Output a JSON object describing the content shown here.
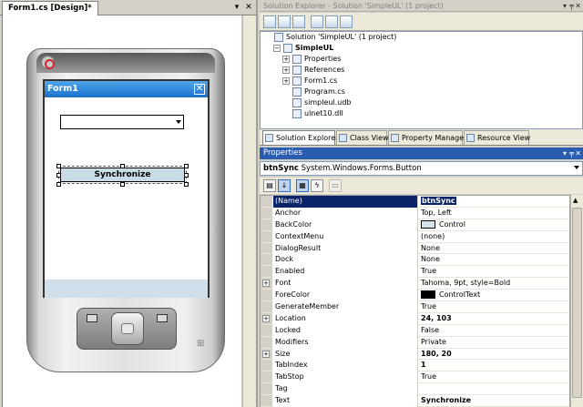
{
  "designer": {
    "tab_label": "Form1.cs [Design]*",
    "form": {
      "title": "Form1",
      "close_glyph": "✕",
      "combo_value": "",
      "button_label": "Synchronize"
    }
  },
  "solution_explorer": {
    "title": "Solution Explorer - Solution 'SimpleUL' (1 project)",
    "tree": [
      {
        "label": "Solution 'SimpleUL' (1 project)",
        "level": 0,
        "expander": "",
        "icon": "solution-icon",
        "bold": false
      },
      {
        "label": "SimpleUL",
        "level": 1,
        "expander": "−",
        "icon": "project-icon",
        "bold": true
      },
      {
        "label": "Properties",
        "level": 2,
        "expander": "+",
        "icon": "folder-icon",
        "bold": false
      },
      {
        "label": "References",
        "level": 2,
        "expander": "+",
        "icon": "folder-icon",
        "bold": false
      },
      {
        "label": "Form1.cs",
        "level": 2,
        "expander": "+",
        "icon": "form-icon",
        "bold": false
      },
      {
        "label": "Program.cs",
        "level": 2,
        "expander": "",
        "icon": "cs-file-icon",
        "bold": false
      },
      {
        "label": "simpleul.udb",
        "level": 2,
        "expander": "",
        "icon": "db-file-icon",
        "bold": false
      },
      {
        "label": "ulnet10.dll",
        "level": 2,
        "expander": "",
        "icon": "dll-file-icon",
        "bold": false
      }
    ]
  },
  "bottom_tabs": [
    {
      "label": "Solution Explorer",
      "active": true
    },
    {
      "label": "Class View",
      "active": false
    },
    {
      "label": "Property Manager",
      "active": false
    },
    {
      "label": "Resource View",
      "active": false
    }
  ],
  "properties": {
    "title": "Properties",
    "object_name": "btnSync",
    "object_type": "System.Windows.Forms.Button",
    "rows": [
      {
        "name": "(Name)",
        "value": "btnSync",
        "bold": true,
        "selected": true,
        "expander": "",
        "swatch": ""
      },
      {
        "name": "Anchor",
        "value": "Top, Left",
        "bold": false,
        "selected": false,
        "expander": "",
        "swatch": ""
      },
      {
        "name": "BackColor",
        "value": "Control",
        "bold": false,
        "selected": false,
        "expander": "",
        "swatch": "#d4e3ec"
      },
      {
        "name": "ContextMenu",
        "value": "(none)",
        "bold": false,
        "selected": false,
        "expander": "",
        "swatch": ""
      },
      {
        "name": "DialogResult",
        "value": "None",
        "bold": false,
        "selected": false,
        "expander": "",
        "swatch": ""
      },
      {
        "name": "Dock",
        "value": "None",
        "bold": false,
        "selected": false,
        "expander": "",
        "swatch": ""
      },
      {
        "name": "Enabled",
        "value": "True",
        "bold": false,
        "selected": false,
        "expander": "",
        "swatch": ""
      },
      {
        "name": "Font",
        "value": "Tahoma, 9pt, style=Bold",
        "bold": false,
        "selected": false,
        "expander": "+",
        "swatch": ""
      },
      {
        "name": "ForeColor",
        "value": "ControlText",
        "bold": false,
        "selected": false,
        "expander": "",
        "swatch": "#000000"
      },
      {
        "name": "GenerateMember",
        "value": "True",
        "bold": false,
        "selected": false,
        "expander": "",
        "swatch": ""
      },
      {
        "name": "Location",
        "value": "24, 103",
        "bold": true,
        "selected": false,
        "expander": "+",
        "swatch": ""
      },
      {
        "name": "Locked",
        "value": "False",
        "bold": false,
        "selected": false,
        "expander": "",
        "swatch": ""
      },
      {
        "name": "Modifiers",
        "value": "Private",
        "bold": false,
        "selected": false,
        "expander": "",
        "swatch": ""
      },
      {
        "name": "Size",
        "value": "180, 20",
        "bold": true,
        "selected": false,
        "expander": "+",
        "swatch": ""
      },
      {
        "name": "TabIndex",
        "value": "1",
        "bold": true,
        "selected": false,
        "expander": "",
        "swatch": ""
      },
      {
        "name": "TabStop",
        "value": "True",
        "bold": false,
        "selected": false,
        "expander": "",
        "swatch": ""
      },
      {
        "name": "Tag",
        "value": "",
        "bold": false,
        "selected": false,
        "expander": "",
        "swatch": ""
      },
      {
        "name": "Text",
        "value": "Synchronize",
        "bold": true,
        "selected": false,
        "expander": "",
        "swatch": ""
      }
    ]
  },
  "colors": {
    "title_active": "#2a5db0",
    "selection": "#0a246a",
    "form_titlebar": "#1b70cc"
  }
}
